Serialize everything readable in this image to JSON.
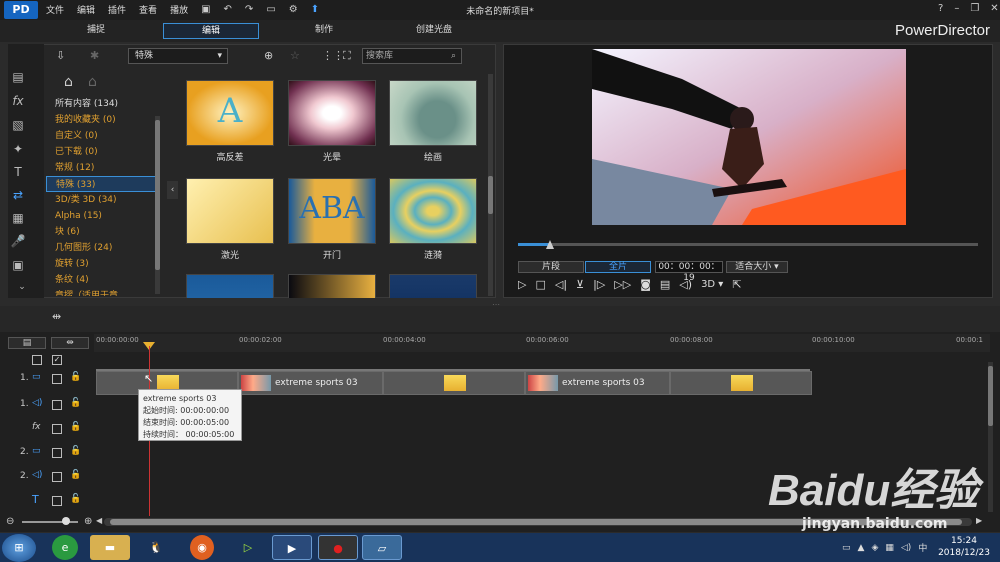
{
  "app": {
    "logo_text": "PD",
    "brand": "PowerDirector",
    "doc_title": "未命名的新项目*"
  },
  "menu": [
    "文件",
    "编辑",
    "插件",
    "查看",
    "播放"
  ],
  "mode_tabs": [
    "捕捉",
    "编辑",
    "制作",
    "创建光盘"
  ],
  "library": {
    "category_select": "特殊",
    "search_placeholder": "搜索库",
    "categories": [
      "所有内容 (134)",
      "我的收藏夹 (0)",
      "自定义 (0)",
      "已下载 (0)",
      "常规 (12)",
      "特殊 (33)",
      "3D/类 3D (34)",
      "Alpha (15)",
      "块 (6)",
      "几何图形 (24)",
      "旋转 (3)",
      "条纹 (4)",
      "章摺（适用于章..."
    ],
    "selected_category_index": 5,
    "thumbnails": [
      {
        "label": "高反差",
        "icon": "letter-a-highcontrast-thumb"
      },
      {
        "label": "光晕",
        "icon": "glow-thumb"
      },
      {
        "label": "绘画",
        "icon": "paint-thumb"
      },
      {
        "label": "激光",
        "icon": "laser-thumb"
      },
      {
        "label": "开门",
        "icon": "door-open-thumb"
      },
      {
        "label": "涟漪",
        "icon": "ripple-thumb"
      }
    ]
  },
  "preview": {
    "clip_button": "片段",
    "movie_button": "全片",
    "timecode": "00：00：00：19",
    "fit_select": "适合大小",
    "mode_3d": "3D",
    "scrub_progress": 0.07
  },
  "timeline": {
    "ruler_ticks": [
      "00:00:00:00",
      "00:00:02:00",
      "00:00:04:00",
      "00:00:06:00",
      "00:00:08:00",
      "00:00:10:00",
      "00:00:1"
    ],
    "tracks": [
      "1.",
      "1.",
      "",
      "2.",
      "2.",
      ""
    ],
    "clip_name": "extreme sports 03",
    "tooltip": {
      "name": "extreme sports 03",
      "start": "起始时间: 00:00:00:00",
      "end": "结束时间: 00:00:05:00",
      "duration": "持续时间： 00:00:05:00"
    }
  },
  "taskbar": {
    "time": "15:24",
    "date": "2018/12/23"
  },
  "watermark": {
    "text": "Baidu经验",
    "url": "jingyan.baidu.com"
  }
}
